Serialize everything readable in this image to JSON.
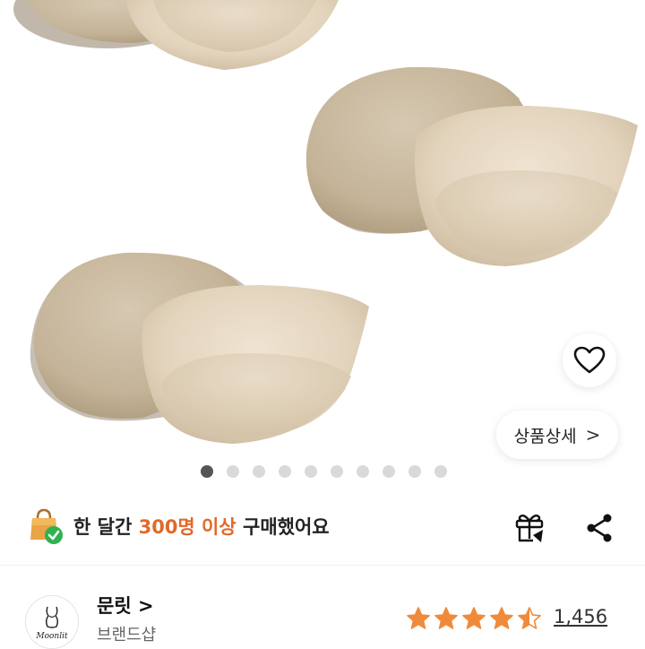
{
  "product": {
    "image_icon": "bra-pad-photo",
    "wish_icon": "heart-outline-icon",
    "detail_label": "상품상세",
    "detail_chevron": ">",
    "gallery_total": 10,
    "gallery_current": 1
  },
  "purchase": {
    "prefix": "한 달간 ",
    "highlight": "300명 이상",
    "suffix": " 구매했어요",
    "highlight_color": "#e06a2a",
    "icon": "shopping-bag-check-icon"
  },
  "actions": {
    "gift_icon": "gift-icon",
    "share_icon": "share-icon"
  },
  "shop": {
    "name": "문릿",
    "chevron": ">",
    "type": "브랜드샵",
    "logo_text": "Moonlit",
    "rating": 4.5,
    "review_count": "1,456",
    "star_color": "#f08a3a"
  }
}
